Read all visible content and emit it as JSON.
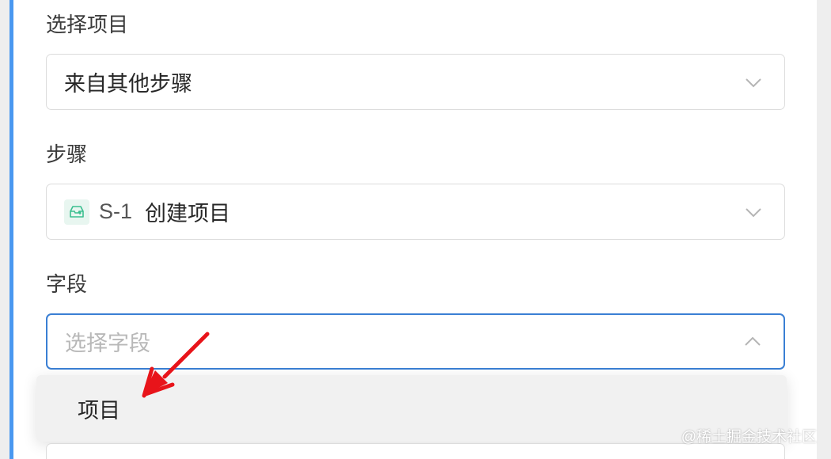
{
  "form": {
    "project_source": {
      "label": "选择项目",
      "value": "来自其他步骤"
    },
    "step": {
      "label": "步骤",
      "step_id": "S-1",
      "step_name": "创建项目",
      "icon": "inbox-upload-icon"
    },
    "field": {
      "label": "字段",
      "placeholder": "选择字段",
      "options": [
        "项目"
      ]
    }
  },
  "watermark": "@稀土掘金技术社区",
  "colors": {
    "accent": "#3a7fd4",
    "left_bar": "#4a98f0",
    "arrow": "#e8141a",
    "step_icon": "#3bbf8f"
  }
}
